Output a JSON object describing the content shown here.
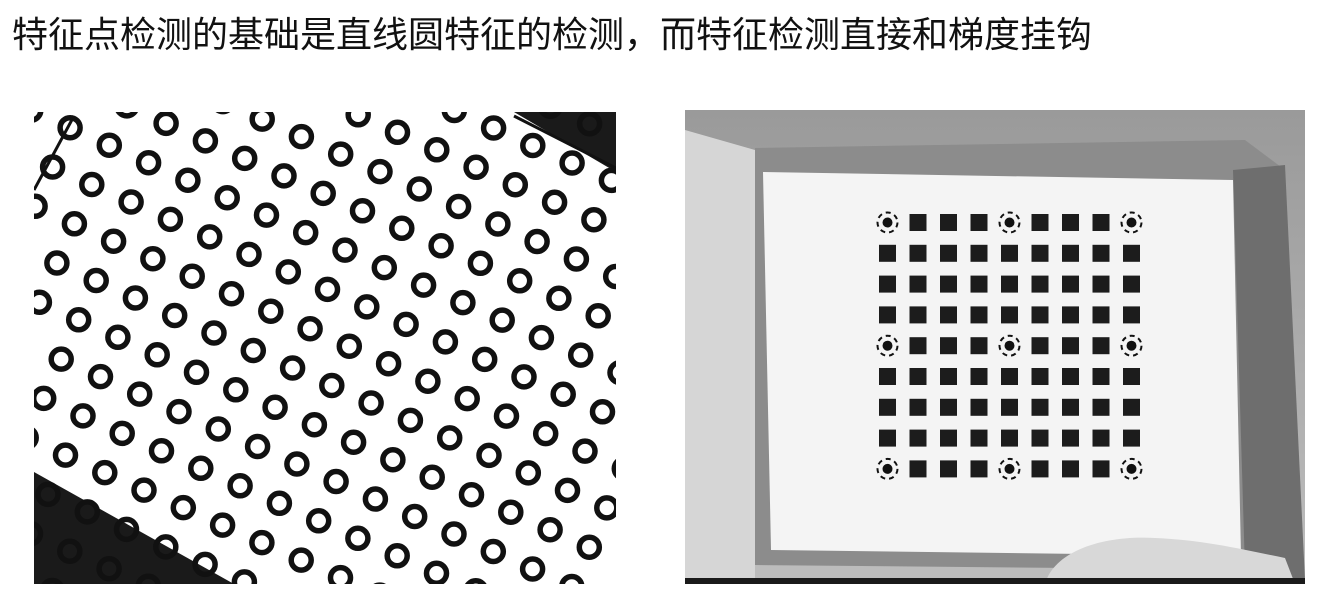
{
  "heading": "特征点检测的基础是直线圆特征的检测，而特征检测直接和梯度挂钩",
  "figures": {
    "left": {
      "subject": "circle-grid-calibration-board"
    },
    "right": {
      "subject": "square-grid-calibration-board-with-detected-points"
    }
  },
  "colors": {
    "ink": "#111111",
    "board": "#f4f4f4",
    "background_dark": "#1a1a1a"
  }
}
